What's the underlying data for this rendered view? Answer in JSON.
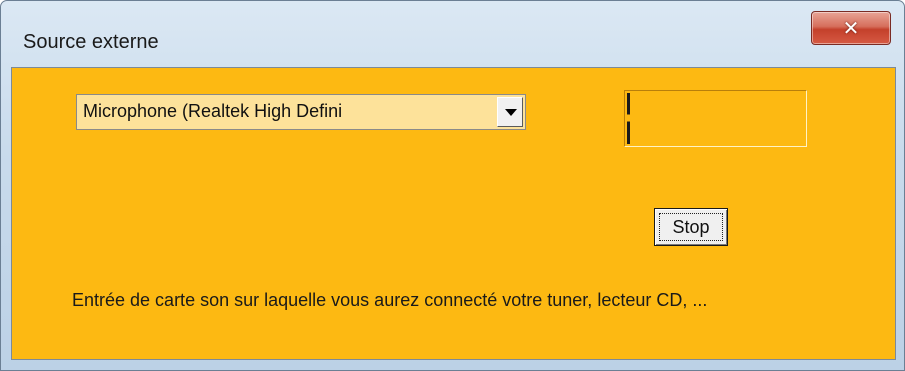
{
  "window": {
    "title": "Source externe",
    "close_glyph": "✕",
    "close_icon": "close-icon"
  },
  "input_source": {
    "selected": "Microphone (Realtek High Defini",
    "dropdown_icon": "chevron-down-icon"
  },
  "level_meter": {
    "value": ""
  },
  "stop_button": {
    "label": "Stop"
  },
  "hint_text": "Entrée de carte son sur laquelle vous aurez connecté votre tuner, lecteur CD, ...",
  "colors": {
    "client_background": "#fdb912",
    "combo_background": "#fde29a",
    "title_bar": "#c9dbec",
    "close_button": "#c4402b"
  }
}
